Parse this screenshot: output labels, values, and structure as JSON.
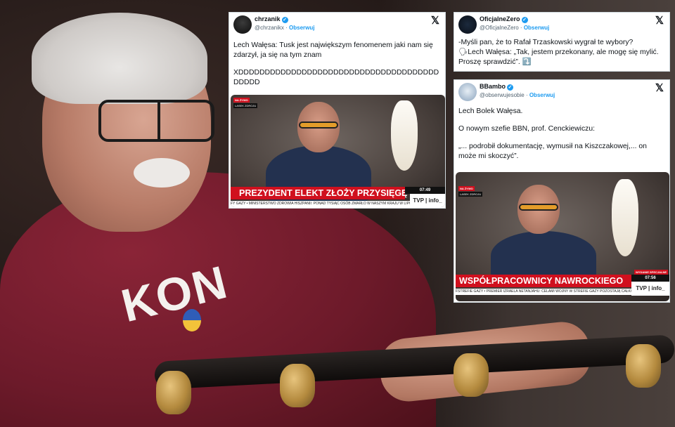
{
  "photo": {
    "sweater_text": "KON"
  },
  "tweets": [
    {
      "username": "chrzanik",
      "handle": "@chrzanikx",
      "follow_label": "Obserwuj",
      "text_lines": [
        "Lech Wałęsa: Tusk jest największym fenomenem jaki nam się zdarzył, ja się na tym znam",
        "XDDDDDDDDDDDDDDDDDDDDDDDDDDDDDDDDDDDDDDDDDDD"
      ],
      "video": {
        "live_label": "NA ŻYWO",
        "sub_label": "LASEK ZDROJU",
        "banner": "PREZYDENT ELEKT ZŁOŻY PRZYSIĘGĘ",
        "clock": "07:49",
        "ticker": "FY GAZY • MINISTERSTWO ZDROWIA HISZPANII: PONAD TYSIĄC OSÓB ZMARŁO W NASZYM KRAJU W LIPC",
        "channel": "TVP | info_"
      }
    },
    {
      "username": "OficjalneZero",
      "handle": "@OficjalneZero",
      "follow_label": "Obserwuj",
      "text_lines": [
        "-Myśli pan, że to Rafał Trzaskowski wygrał te wybory?",
        "🗣Lech Wałęsa: „Tak, jestem przekonany, ale mogę się mylić. Proszę sprawdzić”. ⤵️"
      ]
    },
    {
      "username": "BBambo",
      "handle": "@obserwujesobie",
      "follow_label": "Obserwuj",
      "text_lines": [
        "Lech Bolek Wałęsa.",
        "O nowym szefie BBN, prof. Cenckiewiczu:",
        "„... podrobił dokumentację, wymusił na  Kiszczakowej,... on może mi skoczyć”."
      ],
      "video": {
        "live_label": "NA ŻYWO",
        "sub_label": "LASEK ZDROJU",
        "badge": "WYDANIE SPECJALNE",
        "banner": "WSPÓŁPRACOWNICY NAWROCKIEGO",
        "clock": "07:56",
        "ticker": "FSTREFIE GAZY • PREMIER IZRAELA NETANJAHU: CELAMI WOJNY W STREFIE GAZY POZOSTAJĄ CAŁKOWI",
        "channel": "TVP | info_"
      }
    }
  ],
  "icons": {
    "x_logo": "x-logo-icon",
    "verified": "verified-badge-icon"
  }
}
